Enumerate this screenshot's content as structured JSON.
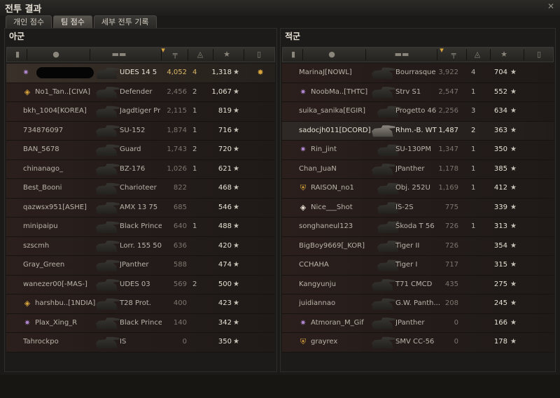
{
  "window": {
    "title": "전투 결과",
    "close_icon": "close-icon"
  },
  "tabs": [
    {
      "label": "개인 점수",
      "active": false
    },
    {
      "label": "팀 점수",
      "active": true
    },
    {
      "label": "세부 전투 기록",
      "active": false
    }
  ],
  "left_team": {
    "title": "아군",
    "players": [
      {
        "name": "",
        "tank": "UDES 14 5",
        "damage": "4,052",
        "kills": "4",
        "xp": "1,318",
        "badge": "gear-icon",
        "class": "self",
        "medal": "medal-icon"
      },
      {
        "name": "No1_Tan..[CIVA]",
        "tank": "Defender",
        "damage": "2,456",
        "kills": "2",
        "xp": "1,067",
        "badge": "diamond-icon"
      },
      {
        "name": "bkh_1004[KOREA]",
        "tank": "Jagdtiger Pr",
        "damage": "2,115",
        "kills": "1",
        "xp": "819"
      },
      {
        "name": "734876097",
        "tank": "SU-152",
        "damage": "1,874",
        "kills": "1",
        "xp": "716"
      },
      {
        "name": "BAN_5678",
        "tank": "Guard",
        "damage": "1,743",
        "kills": "2",
        "xp": "720"
      },
      {
        "name": "chinanago_",
        "tank": "BZ-176",
        "damage": "1,026",
        "kills": "1",
        "xp": "621"
      },
      {
        "name": "Best_Booni",
        "tank": "Charioteer",
        "damage": "822",
        "kills": "",
        "xp": "468"
      },
      {
        "name": "qazwsx951[ASHE]",
        "tank": "AMX 13 75",
        "damage": "685",
        "kills": "",
        "xp": "546"
      },
      {
        "name": "minipaipu",
        "tank": "Black Prince",
        "damage": "640",
        "kills": "1",
        "xp": "488"
      },
      {
        "name": "szscmh",
        "tank": "Lorr. 155 50",
        "damage": "636",
        "kills": "",
        "xp": "420"
      },
      {
        "name": "Gray_Green",
        "tank": "JPanther",
        "damage": "588",
        "kills": "",
        "xp": "474"
      },
      {
        "name": "wanezer00[-MAS-]",
        "tank": "UDES 03",
        "damage": "569",
        "kills": "2",
        "xp": "500"
      },
      {
        "name": "harshbu..[1NDIA]",
        "tank": "T28 Prot.",
        "damage": "400",
        "kills": "",
        "xp": "423",
        "badge": "diamond-icon"
      },
      {
        "name": "Plax_Xing_R",
        "tank": "Black Prince",
        "damage": "140",
        "kills": "",
        "xp": "342",
        "badge": "gear-icon"
      },
      {
        "name": "Tahrockpo",
        "tank": "IS",
        "damage": "0",
        "kills": "",
        "xp": "350"
      }
    ]
  },
  "right_team": {
    "title": "적군",
    "players": [
      {
        "name": "MarinaJ[NOWL]",
        "tank": "Bourrasque",
        "damage": "3,922",
        "kills": "4",
        "xp": "704"
      },
      {
        "name": "NoobMa..[THTC]",
        "tank": "Strv S1",
        "damage": "2,547",
        "kills": "1",
        "xp": "552",
        "badge": "gear-icon"
      },
      {
        "name": "suika_sanika[EGIR]",
        "tank": "Progetto 46",
        "damage": "2,256",
        "kills": "3",
        "xp": "634"
      },
      {
        "name": "sadocjh011[DCORD]",
        "tank": "Rhm.-B. WT",
        "damage": "1,487",
        "kills": "2",
        "xp": "363",
        "class": "hl"
      },
      {
        "name": "Rin_jint",
        "tank": "SU-130PM",
        "damage": "1,347",
        "kills": "1",
        "xp": "350",
        "badge": "gear-icon"
      },
      {
        "name": "Chan_JuaN",
        "tank": "JPanther",
        "damage": "1,178",
        "kills": "1",
        "xp": "385"
      },
      {
        "name": "RAISON_no1",
        "tank": "Obj. 252U",
        "damage": "1,169",
        "kills": "1",
        "xp": "412",
        "badge": "shield-icon"
      },
      {
        "name": "Nice___Shot",
        "tank": "IS-2S",
        "damage": "775",
        "kills": "",
        "xp": "339",
        "badge": "diamond-icon"
      },
      {
        "name": "songhaneul123",
        "tank": "Škoda T 56",
        "damage": "726",
        "kills": "1",
        "xp": "313"
      },
      {
        "name": "BigBoy9669[_KOR]",
        "tank": "Tiger II",
        "damage": "726",
        "kills": "",
        "xp": "354"
      },
      {
        "name": "CCHAHA",
        "tank": "Tiger I",
        "damage": "717",
        "kills": "",
        "xp": "315"
      },
      {
        "name": "Kangyunju",
        "tank": "T71 CMCD",
        "damage": "435",
        "kills": "",
        "xp": "275"
      },
      {
        "name": "juidiannao",
        "tank": "G.W. Panth...",
        "damage": "208",
        "kills": "",
        "xp": "245"
      },
      {
        "name": "Atmoran_M_Gif",
        "tank": "JPanther",
        "damage": "0",
        "kills": "",
        "xp": "166",
        "badge": "gear-icon"
      },
      {
        "name": "grayrex",
        "tank": "SMV CC-56",
        "damage": "0",
        "kills": "",
        "xp": "178",
        "badge": "shield-icon"
      }
    ]
  },
  "header_icons": [
    "rank-icon",
    "player-icon",
    "tank-icon",
    "sort-icon",
    "damage-icon",
    "kills-icon",
    "xp-star-icon",
    "medal-icon"
  ],
  "colors": {
    "accent": "#d9a53c",
    "self_row": "#3a302a",
    "panel_bg": "#1c1b19"
  }
}
